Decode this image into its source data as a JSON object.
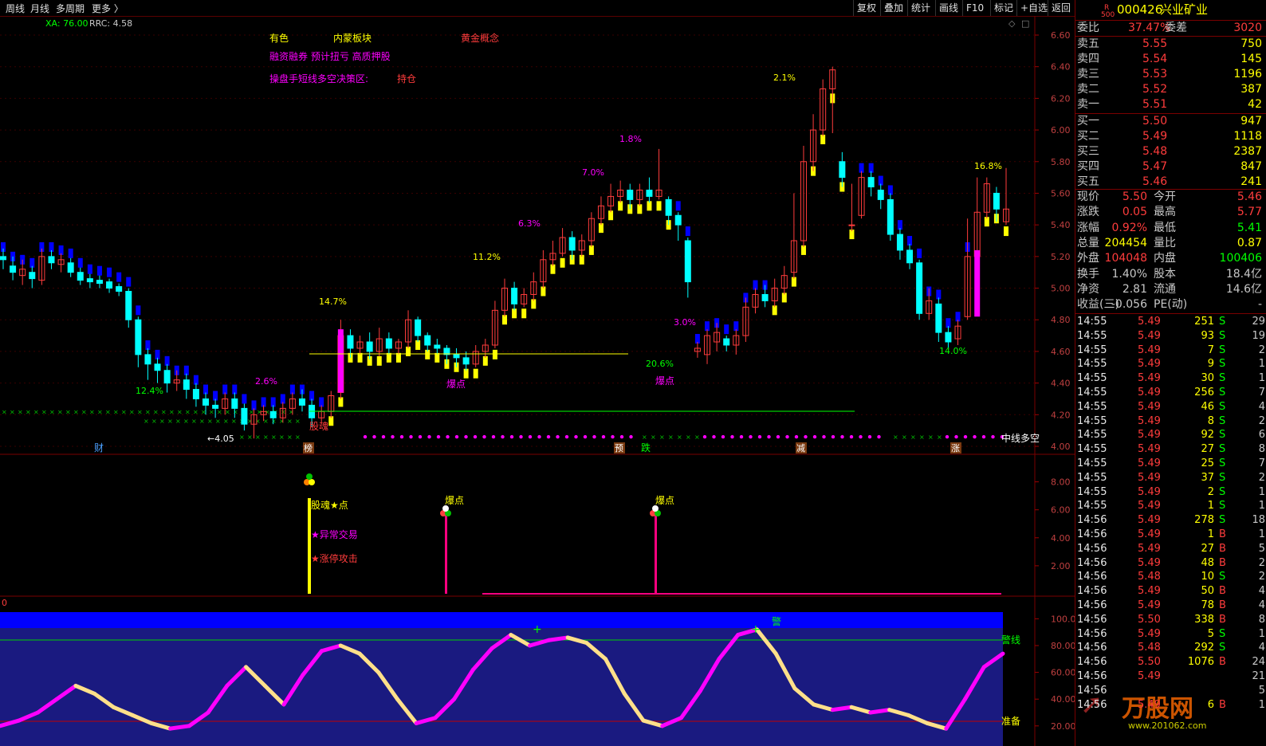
{
  "toolbar": {
    "left_items": [
      "周线",
      "月线",
      "多周期",
      "更多 〉"
    ],
    "right_items": [
      "复权",
      "叠加",
      "统计",
      "画线",
      "F10",
      "标记",
      "+自选",
      "返回"
    ]
  },
  "indicator_header": {
    "xa": "XA: 76.00",
    "rrc": "RRC: 4.58"
  },
  "main_panel": {
    "tags": {
      "color_tag": "有色",
      "sector": "内蒙板块",
      "concept": "黄金概念",
      "tags_line": "融资融券  预计扭亏  高质押股",
      "strategy_label": "操盘手短线多空决策区:",
      "strategy_value": "持仓"
    },
    "y_ticks": [
      "6.60",
      "6.40",
      "6.20",
      "6.00",
      "5.80",
      "5.60",
      "5.40",
      "5.20",
      "5.00",
      "4.80",
      "4.60",
      "4.40",
      "4.20",
      "4.00"
    ],
    "pct_labels": [
      "14.7%",
      "11.2%",
      "6.3%",
      "7.0%",
      "1.8%",
      "2.6%",
      "12.4%",
      "20.6%",
      "3.0%",
      "2.1%",
      "16.8%",
      "14.0%"
    ],
    "low_label": "←4.05",
    "bottom_signals": [
      "财",
      "榜",
      "预",
      "跌",
      "减",
      "涨"
    ],
    "marker_labels": [
      "股魂",
      "爆点",
      "爆点"
    ],
    "right_label": "中线多空"
  },
  "mid_panel": {
    "y_ticks": [
      "8.00",
      "6.00",
      "4.00",
      "2.00"
    ],
    "labels": [
      "股魂★点",
      "★异常交易",
      "★涨停攻击",
      "爆点",
      "爆点"
    ]
  },
  "lower_panel": {
    "zero_label": "0",
    "y_ticks": [
      "100.0",
      "80.00",
      "60.00",
      "40.00",
      "20.00"
    ],
    "labels": [
      "警线",
      "准备",
      "警"
    ]
  },
  "quote": {
    "code": "000426",
    "name": "兴业矿业",
    "badge_top": "R",
    "badge_bottom": "500",
    "weibi_label": "委比",
    "weibi": "37.47%",
    "weicha_label": "委差",
    "weicha": "3020",
    "asks": [
      {
        "label": "卖五",
        "price": "5.55",
        "vol": "750"
      },
      {
        "label": "卖四",
        "price": "5.54",
        "vol": "145"
      },
      {
        "label": "卖三",
        "price": "5.53",
        "vol": "1196"
      },
      {
        "label": "卖二",
        "price": "5.52",
        "vol": "387"
      },
      {
        "label": "卖一",
        "price": "5.51",
        "vol": "42"
      }
    ],
    "bids": [
      {
        "label": "买一",
        "price": "5.50",
        "vol": "947"
      },
      {
        "label": "买二",
        "price": "5.49",
        "vol": "1118"
      },
      {
        "label": "买三",
        "price": "5.48",
        "vol": "2387"
      },
      {
        "label": "买四",
        "price": "5.47",
        "vol": "847"
      },
      {
        "label": "买五",
        "price": "5.46",
        "vol": "241"
      }
    ],
    "stats": [
      {
        "l1": "现价",
        "v1": "5.50",
        "l2": "今开",
        "v2": "5.46"
      },
      {
        "l1": "涨跌",
        "v1": "0.05",
        "l2": "最高",
        "v2": "5.77"
      },
      {
        "l1": "涨幅",
        "v1": "0.92%",
        "l2": "最低",
        "v2": "5.41"
      },
      {
        "l1": "总量",
        "v1": "204454",
        "l2": "量比",
        "v2": "0.87"
      },
      {
        "l1": "外盘",
        "v1": "104048",
        "l2": "内盘",
        "v2": "100406"
      },
      {
        "l1": "换手",
        "v1": "1.40%",
        "l2": "股本",
        "v2": "18.4亿"
      },
      {
        "l1": "净资",
        "v1": "2.81",
        "l2": "流通",
        "v2": "14.6亿"
      },
      {
        "l1": "收益(三)",
        "v1": "-0.056",
        "l2": "PE(动)",
        "v2": "-"
      }
    ],
    "ticks": [
      [
        "14:55",
        "5.49",
        "251",
        "S",
        "29"
      ],
      [
        "14:55",
        "5.49",
        "93",
        "S",
        "19"
      ],
      [
        "14:55",
        "5.49",
        "7",
        "S",
        "2"
      ],
      [
        "14:55",
        "5.49",
        "9",
        "S",
        "1"
      ],
      [
        "14:55",
        "5.49",
        "30",
        "S",
        "1"
      ],
      [
        "14:55",
        "5.49",
        "256",
        "S",
        "7"
      ],
      [
        "14:55",
        "5.49",
        "46",
        "S",
        "4"
      ],
      [
        "14:55",
        "5.49",
        "8",
        "S",
        "2"
      ],
      [
        "14:55",
        "5.49",
        "92",
        "S",
        "6"
      ],
      [
        "14:55",
        "5.49",
        "27",
        "S",
        "8"
      ],
      [
        "14:55",
        "5.49",
        "25",
        "S",
        "7"
      ],
      [
        "14:55",
        "5.49",
        "37",
        "S",
        "2"
      ],
      [
        "14:55",
        "5.49",
        "2",
        "S",
        "1"
      ],
      [
        "14:55",
        "5.49",
        "1",
        "S",
        "1"
      ],
      [
        "14:56",
        "5.49",
        "278",
        "S",
        "18"
      ],
      [
        "14:56",
        "5.49",
        "1",
        "B",
        "1"
      ],
      [
        "14:56",
        "5.49",
        "27",
        "B",
        "5"
      ],
      [
        "14:56",
        "5.49",
        "48",
        "B",
        "2"
      ],
      [
        "14:56",
        "5.48",
        "10",
        "S",
        "2"
      ],
      [
        "14:56",
        "5.49",
        "50",
        "B",
        "4"
      ],
      [
        "14:56",
        "5.49",
        "78",
        "B",
        "4"
      ],
      [
        "14:56",
        "5.50",
        "338",
        "B",
        "8"
      ],
      [
        "14:56",
        "5.49",
        "5",
        "S",
        "1"
      ],
      [
        "14:56",
        "5.48",
        "292",
        "S",
        "4"
      ],
      [
        "14:56",
        "5.50",
        "1076",
        "B",
        "24"
      ],
      [
        "14:56",
        "5.49",
        "",
        "",
        "21"
      ],
      [
        "14:56",
        "",
        "",
        "",
        "5"
      ],
      [
        "14:56",
        "5.49",
        "6",
        "B",
        "1"
      ]
    ]
  },
  "watermark": {
    "brand": "万股网",
    "url": "www.201062.com"
  },
  "colors": {
    "up": "#ff3c3c",
    "down": "#00ffff",
    "yellow": "#ffff00",
    "blue": "#0000ff",
    "magenta": "#ff00ff",
    "green": "#00ff00",
    "grid": "#5a0000"
  },
  "chart_data": [
    {
      "type": "candlestick",
      "ylim": [
        4.0,
        6.6
      ],
      "bars": [
        [
          5.2,
          5.18,
          5.25,
          5.12
        ],
        [
          5.14,
          5.1,
          5.2,
          5.05
        ],
        [
          5.08,
          5.12,
          5.18,
          5.02
        ],
        [
          5.1,
          5.06,
          5.14,
          5.0
        ],
        [
          5.05,
          5.2,
          5.25,
          5.02
        ],
        [
          5.2,
          5.16,
          5.24,
          5.12
        ],
        [
          5.15,
          5.18,
          5.22,
          5.1
        ],
        [
          5.16,
          5.1,
          5.19,
          5.07
        ],
        [
          5.1,
          5.05,
          5.13,
          5.02
        ],
        [
          5.06,
          5.04,
          5.09,
          5.0
        ],
        [
          5.05,
          5.03,
          5.08,
          5.0
        ],
        [
          5.04,
          5.0,
          5.06,
          4.97
        ],
        [
          5.01,
          4.98,
          5.03,
          4.95
        ],
        [
          4.98,
          4.8,
          5.0,
          4.75
        ],
        [
          4.8,
          4.58,
          4.82,
          4.5
        ],
        [
          4.58,
          4.52,
          4.62,
          4.42
        ],
        [
          4.52,
          4.48,
          4.56,
          4.4
        ],
        [
          4.48,
          4.4,
          4.52,
          4.34
        ],
        [
          4.4,
          4.42,
          4.48,
          4.35
        ],
        [
          4.42,
          4.36,
          4.46,
          4.3
        ],
        [
          4.36,
          4.3,
          4.4,
          4.25
        ],
        [
          4.3,
          4.26,
          4.34,
          4.2
        ],
        [
          4.26,
          4.24,
          4.3,
          4.18
        ],
        [
          4.24,
          4.3,
          4.34,
          4.2
        ],
        [
          4.3,
          4.24,
          4.34,
          4.18
        ],
        [
          4.24,
          4.14,
          4.27,
          4.1
        ],
        [
          4.14,
          4.2,
          4.24,
          4.05
        ],
        [
          4.2,
          4.22,
          4.26,
          4.16
        ],
        [
          4.22,
          4.18,
          4.26,
          4.14
        ],
        [
          4.18,
          4.24,
          4.28,
          4.15
        ],
        [
          4.24,
          4.3,
          4.34,
          4.2
        ],
        [
          4.3,
          4.26,
          4.36,
          4.22
        ],
        [
          4.26,
          4.18,
          4.3,
          4.12
        ],
        [
          4.18,
          4.22,
          4.26,
          4.14
        ],
        [
          4.22,
          4.32,
          4.35,
          4.18
        ],
        [
          4.34,
          4.7,
          4.8,
          4.3
        ],
        [
          4.7,
          4.62,
          4.74,
          4.56
        ],
        [
          4.62,
          4.66,
          4.7,
          4.58
        ],
        [
          4.66,
          4.6,
          4.72,
          4.55
        ],
        [
          4.6,
          4.68,
          4.75,
          4.57
        ],
        [
          4.68,
          4.62,
          4.72,
          4.58
        ],
        [
          4.62,
          4.66,
          4.68,
          4.58
        ],
        [
          4.66,
          4.8,
          4.86,
          4.62
        ],
        [
          4.8,
          4.7,
          4.82,
          4.66
        ],
        [
          4.7,
          4.64,
          4.72,
          4.6
        ],
        [
          4.64,
          4.62,
          4.68,
          4.58
        ],
        [
          4.62,
          4.58,
          4.64,
          4.52
        ],
        [
          4.58,
          4.56,
          4.62,
          4.5
        ],
        [
          4.56,
          4.52,
          4.6,
          4.48
        ],
        [
          4.52,
          4.6,
          4.64,
          4.5
        ],
        [
          4.6,
          4.64,
          4.68,
          4.56
        ],
        [
          4.64,
          4.86,
          4.92,
          4.62
        ],
        [
          4.86,
          5.0,
          5.06,
          4.82
        ],
        [
          5.0,
          4.9,
          5.04,
          4.86
        ],
        [
          4.9,
          4.96,
          5.0,
          4.88
        ],
        [
          4.96,
          5.04,
          5.1,
          4.92
        ],
        [
          5.04,
          5.18,
          5.24,
          5.0
        ],
        [
          5.18,
          5.22,
          5.3,
          5.14
        ],
        [
          5.22,
          5.32,
          5.38,
          5.2
        ],
        [
          5.32,
          5.24,
          5.36,
          5.18
        ],
        [
          5.24,
          5.3,
          5.34,
          5.2
        ],
        [
          5.3,
          5.44,
          5.48,
          5.26
        ],
        [
          5.44,
          5.52,
          5.58,
          5.4
        ],
        [
          5.52,
          5.58,
          5.66,
          5.48
        ],
        [
          5.58,
          5.62,
          5.68,
          5.54
        ],
        [
          5.62,
          5.56,
          5.66,
          5.5
        ],
        [
          5.56,
          5.62,
          5.66,
          5.52
        ],
        [
          5.62,
          5.58,
          5.7,
          5.54
        ],
        [
          5.58,
          5.62,
          5.88,
          5.56
        ],
        [
          5.56,
          5.46,
          5.58,
          5.4
        ],
        [
          5.46,
          5.4,
          5.48,
          5.3
        ],
        [
          5.3,
          5.04,
          5.32,
          4.94
        ],
        [
          4.6,
          4.62,
          4.66,
          4.56
        ],
        [
          4.58,
          4.7,
          4.74,
          4.52
        ],
        [
          4.66,
          4.72,
          4.78,
          4.6
        ],
        [
          4.68,
          4.64,
          4.7,
          4.6
        ],
        [
          4.64,
          4.7,
          4.74,
          4.58
        ],
        [
          4.7,
          4.88,
          4.94,
          4.66
        ],
        [
          4.88,
          4.96,
          5.0,
          4.84
        ],
        [
          4.96,
          4.92,
          5.02,
          4.88
        ],
        [
          4.92,
          5.0,
          5.06,
          4.88
        ],
        [
          5.0,
          5.08,
          5.14,
          4.96
        ],
        [
          5.1,
          5.3,
          5.6,
          5.06
        ],
        [
          5.3,
          5.8,
          5.9,
          5.26
        ],
        [
          5.8,
          6.0,
          6.1,
          5.74
        ],
        [
          6.0,
          6.26,
          6.32,
          5.96
        ],
        [
          6.26,
          6.38,
          6.4,
          5.98
        ],
        [
          5.8,
          5.7,
          5.86,
          5.64
        ],
        [
          5.4,
          5.4,
          5.66,
          5.36
        ],
        [
          5.46,
          5.7,
          5.74,
          5.44
        ],
        [
          5.7,
          5.64,
          5.74,
          5.58
        ],
        [
          5.62,
          5.56,
          5.66,
          5.5
        ],
        [
          5.56,
          5.34,
          5.6,
          5.3
        ],
        [
          5.34,
          5.24,
          5.38,
          5.18
        ],
        [
          5.24,
          5.16,
          5.28,
          5.12
        ],
        [
          5.16,
          4.84,
          5.18,
          4.8
        ],
        [
          4.84,
          4.92,
          5.0,
          4.8
        ],
        [
          4.9,
          4.72,
          4.94,
          4.66
        ],
        [
          4.72,
          4.66,
          4.76,
          4.62
        ],
        [
          4.68,
          4.76,
          4.8,
          4.64
        ],
        [
          4.82,
          5.2,
          5.44,
          4.8
        ],
        [
          5.2,
          5.48,
          5.7,
          5.18
        ],
        [
          5.48,
          5.66,
          5.7,
          5.44
        ],
        [
          5.6,
          5.5,
          5.64,
          5.42
        ],
        [
          5.42,
          5.5,
          5.76,
          5.4
        ]
      ]
    },
    {
      "type": "line",
      "name": "lower-oscillator",
      "ylim": [
        20,
        100
      ],
      "values": [
        20,
        24,
        30,
        40,
        50,
        44,
        34,
        28,
        22,
        18,
        20,
        30,
        50,
        64,
        50,
        36,
        58,
        76,
        80,
        74,
        60,
        40,
        22,
        26,
        40,
        62,
        78,
        88,
        80,
        84,
        86,
        82,
        70,
        44,
        24,
        20,
        26,
        46,
        70,
        88,
        92,
        74,
        48,
        36,
        32,
        34,
        30,
        32,
        28,
        22,
        18,
        40,
        64,
        74
      ]
    }
  ]
}
